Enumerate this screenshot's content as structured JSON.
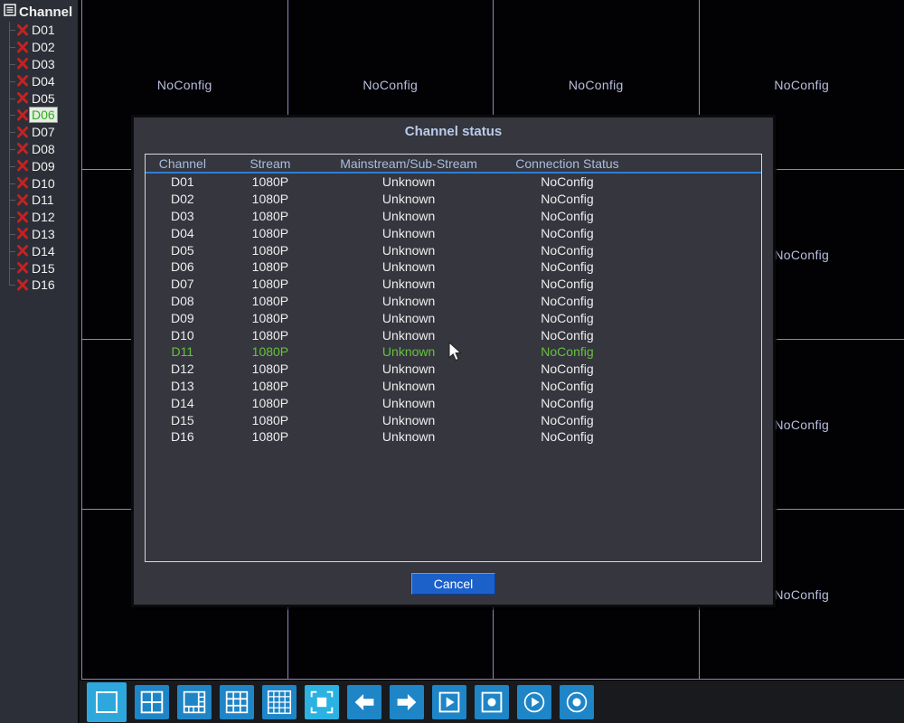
{
  "sidebar": {
    "title": "Channel",
    "items": [
      {
        "label": "D01",
        "selected": false
      },
      {
        "label": "D02",
        "selected": false
      },
      {
        "label": "D03",
        "selected": false
      },
      {
        "label": "D04",
        "selected": false
      },
      {
        "label": "D05",
        "selected": false
      },
      {
        "label": "D06",
        "selected": true
      },
      {
        "label": "D07",
        "selected": false
      },
      {
        "label": "D08",
        "selected": false
      },
      {
        "label": "D09",
        "selected": false
      },
      {
        "label": "D10",
        "selected": false
      },
      {
        "label": "D11",
        "selected": false
      },
      {
        "label": "D12",
        "selected": false
      },
      {
        "label": "D13",
        "selected": false
      },
      {
        "label": "D14",
        "selected": false
      },
      {
        "label": "D15",
        "selected": false
      },
      {
        "label": "D16",
        "selected": false
      }
    ]
  },
  "grid": {
    "rows": 4,
    "cols": 4,
    "cell_label": "NoConfig"
  },
  "dialog": {
    "title": "Channel status",
    "table": {
      "headers": [
        "Channel",
        "Stream",
        "Mainstream/Sub-Stream",
        "Connection Status"
      ],
      "rows": [
        {
          "channel": "D01",
          "stream": "1080P",
          "mainstream": "Unknown",
          "status": "NoConfig",
          "highlight": false
        },
        {
          "channel": "D02",
          "stream": "1080P",
          "mainstream": "Unknown",
          "status": "NoConfig",
          "highlight": false
        },
        {
          "channel": "D03",
          "stream": "1080P",
          "mainstream": "Unknown",
          "status": "NoConfig",
          "highlight": false
        },
        {
          "channel": "D04",
          "stream": "1080P",
          "mainstream": "Unknown",
          "status": "NoConfig",
          "highlight": false
        },
        {
          "channel": "D05",
          "stream": "1080P",
          "mainstream": "Unknown",
          "status": "NoConfig",
          "highlight": false
        },
        {
          "channel": "D06",
          "stream": "1080P",
          "mainstream": "Unknown",
          "status": "NoConfig",
          "highlight": false
        },
        {
          "channel": "D07",
          "stream": "1080P",
          "mainstream": "Unknown",
          "status": "NoConfig",
          "highlight": false
        },
        {
          "channel": "D08",
          "stream": "1080P",
          "mainstream": "Unknown",
          "status": "NoConfig",
          "highlight": false
        },
        {
          "channel": "D09",
          "stream": "1080P",
          "mainstream": "Unknown",
          "status": "NoConfig",
          "highlight": false
        },
        {
          "channel": "D10",
          "stream": "1080P",
          "mainstream": "Unknown",
          "status": "NoConfig",
          "highlight": false
        },
        {
          "channel": "D11",
          "stream": "1080P",
          "mainstream": "Unknown",
          "status": "NoConfig",
          "highlight": true
        },
        {
          "channel": "D12",
          "stream": "1080P",
          "mainstream": "Unknown",
          "status": "NoConfig",
          "highlight": false
        },
        {
          "channel": "D13",
          "stream": "1080P",
          "mainstream": "Unknown",
          "status": "NoConfig",
          "highlight": false
        },
        {
          "channel": "D14",
          "stream": "1080P",
          "mainstream": "Unknown",
          "status": "NoConfig",
          "highlight": false
        },
        {
          "channel": "D15",
          "stream": "1080P",
          "mainstream": "Unknown",
          "status": "NoConfig",
          "highlight": false
        },
        {
          "channel": "D16",
          "stream": "1080P",
          "mainstream": "Unknown",
          "status": "NoConfig",
          "highlight": false
        }
      ]
    },
    "cancel_label": "Cancel"
  },
  "toolbar": {
    "buttons": [
      {
        "icon": "view-single-icon",
        "active": true
      },
      {
        "icon": "view-quad-icon",
        "active": false
      },
      {
        "icon": "view-eight-icon",
        "active": false
      },
      {
        "icon": "view-nine-icon",
        "active": false
      },
      {
        "icon": "view-sixteen-icon",
        "active": false
      },
      {
        "icon": "pip-focus-icon",
        "active": true
      },
      {
        "icon": "prev-arrow-icon",
        "active": false
      },
      {
        "icon": "next-arrow-icon",
        "active": false
      },
      {
        "icon": "play-square-icon",
        "active": false
      },
      {
        "icon": "record-square-icon",
        "active": false
      },
      {
        "icon": "play-circle-icon",
        "active": false
      },
      {
        "icon": "record-circle-icon",
        "active": false
      }
    ]
  },
  "colors": {
    "sidebar_bg": "#2c2f37",
    "grid_line": "#8f85ba",
    "cell_text": "#b9bede",
    "dialog_bg": "#35363e",
    "title_text": "#b9cbe9",
    "header_text": "#a9bede",
    "header_underline": "#2e7ed6",
    "row_text": "#eeeeee",
    "highlight_row": "#67c23d",
    "selected_channel_text": "#2fae1e",
    "disconnect_x": "#c32222",
    "button_blue": "#1e85c7",
    "button_light_blue": "#2ea8dc",
    "cancel_bg": "#1c60ca"
  }
}
